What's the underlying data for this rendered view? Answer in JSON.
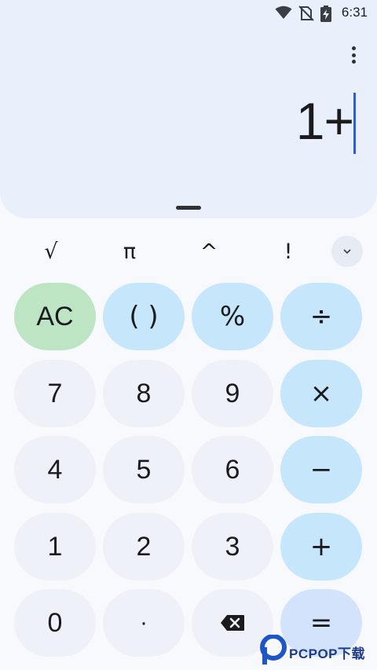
{
  "status_bar": {
    "time": "6:31"
  },
  "display": {
    "expression": "1+"
  },
  "scientific": {
    "keys": [
      "√",
      "π",
      "^",
      "!"
    ]
  },
  "keypad": {
    "ac": "AC",
    "parens": "( )",
    "percent": "%",
    "divide": "÷",
    "seven": "7",
    "eight": "8",
    "nine": "9",
    "multiply": "×",
    "four": "4",
    "five": "5",
    "six": "6",
    "minus": "−",
    "one": "1",
    "two": "2",
    "three": "3",
    "plus": "+",
    "zero": "0",
    "decimal": "·",
    "equals": "="
  },
  "colors": {
    "display_bg": "#eaf0fb",
    "number_key": "#eef2f8",
    "operator_key": "#c6e6fb",
    "clear_key": "#bde5c4",
    "equals_key": "#d2e3fb",
    "cursor": "#2b5fd1"
  }
}
